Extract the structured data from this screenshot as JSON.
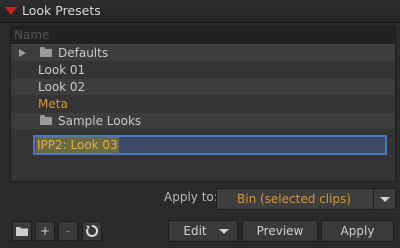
{
  "title": "Look Presets",
  "list": {
    "header": "Name",
    "rows": [
      {
        "label": "Defaults",
        "type": "folder"
      },
      {
        "label": "Look 01",
        "type": "item"
      },
      {
        "label": "Look 02",
        "type": "item"
      },
      {
        "label": "Meta",
        "type": "category"
      },
      {
        "label": "Sample Looks",
        "type": "folder"
      }
    ],
    "editing_value": "IPP2: Look 03"
  },
  "apply_to": {
    "label": "Apply to:",
    "value": "Bin (selected clips)"
  },
  "buttons": {
    "add": "+",
    "remove": "-",
    "edit": "Edit",
    "preview": "Preview",
    "apply": "Apply"
  },
  "icons": {
    "collapse": "collapse-triangle-icon",
    "folder": "folder-icon",
    "refresh": "refresh-icon",
    "dropdown": "chevron-down-icon"
  },
  "colors": {
    "accent_red": "#d41e1e",
    "category_orange": "#d8952e",
    "edit_border_blue": "#4c78c0"
  }
}
